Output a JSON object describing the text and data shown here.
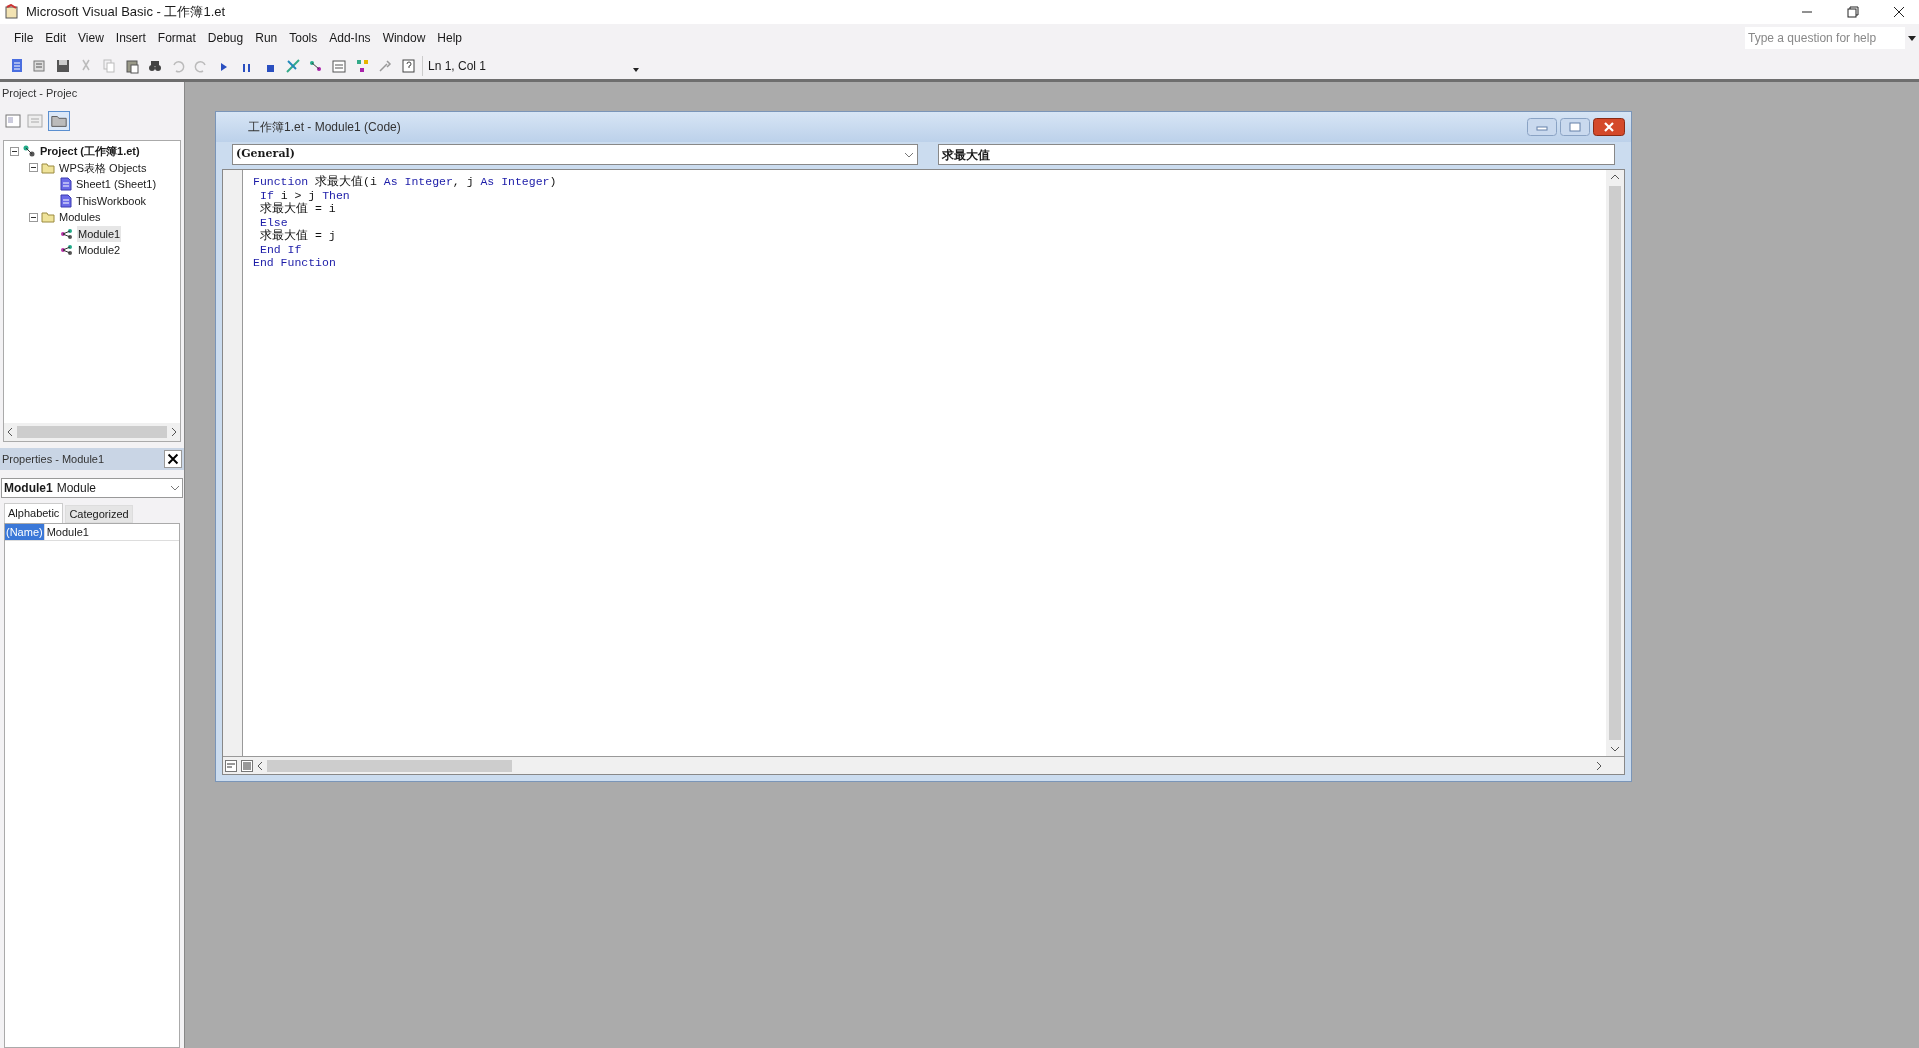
{
  "window": {
    "title": "Microsoft Visual Basic - 工作簿1.et"
  },
  "menu": [
    "File",
    "Edit",
    "View",
    "Insert",
    "Format",
    "Debug",
    "Run",
    "Tools",
    "Add-Ins",
    "Window",
    "Help"
  ],
  "toolbar": {
    "position": "Ln 1, Col 1"
  },
  "help_box": {
    "placeholder": "Type a question for help"
  },
  "project_explorer": {
    "title": "Project - Projec",
    "tree": [
      {
        "label": "Project (工作簿1.et)",
        "kind": "project",
        "expanded": true,
        "children": [
          {
            "label": "WPS表格 Objects",
            "kind": "folder",
            "expanded": true,
            "children": [
              {
                "label": "Sheet1 (Sheet1)",
                "kind": "sheet",
                "selected": false
              },
              {
                "label": "ThisWorkbook",
                "kind": "sheet",
                "selected": false
              }
            ]
          },
          {
            "label": "Modules",
            "kind": "folder",
            "expanded": true,
            "children": [
              {
                "label": "Module1",
                "kind": "module",
                "selected": true
              },
              {
                "label": "Module2",
                "kind": "module",
                "selected": false
              }
            ]
          }
        ]
      }
    ]
  },
  "properties": {
    "title": "Properties - Module1",
    "object_name": "Module1",
    "object_type": "Module",
    "tabs": [
      {
        "label": "Alphabetic",
        "selected": true
      },
      {
        "label": "Categorized",
        "selected": false
      }
    ],
    "rows": [
      {
        "name": "(Name)",
        "value": "Module1",
        "selected": true
      }
    ]
  },
  "code_window": {
    "title": "工作簿1.et - Module1 (Code)",
    "object_dropdown": "(General)",
    "procedure_dropdown": "求最大值",
    "lines": [
      [
        {
          "kind": "keyword",
          "text": "Function"
        },
        {
          "kind": "plain",
          "text": " 求最大值(i "
        },
        {
          "kind": "keyword",
          "text": "As Integer"
        },
        {
          "kind": "plain",
          "text": ", j "
        },
        {
          "kind": "keyword",
          "text": "As Integer"
        },
        {
          "kind": "plain",
          "text": ")"
        }
      ],
      [
        {
          "kind": "indent"
        },
        {
          "kind": "keyword",
          "text": "If"
        },
        {
          "kind": "plain",
          "text": " i > j "
        },
        {
          "kind": "keyword",
          "text": "Then"
        }
      ],
      [
        {
          "kind": "indent"
        },
        {
          "kind": "plain",
          "text": "求最大值 = i"
        }
      ],
      [
        {
          "kind": "indent"
        },
        {
          "kind": "keyword",
          "text": "Else"
        }
      ],
      [
        {
          "kind": "indent"
        },
        {
          "kind": "plain",
          "text": "求最大值 = j"
        }
      ],
      [
        {
          "kind": "indent"
        },
        {
          "kind": "keyword",
          "text": "End If"
        }
      ],
      [
        {
          "kind": "keyword",
          "text": "End Function"
        }
      ]
    ]
  }
}
